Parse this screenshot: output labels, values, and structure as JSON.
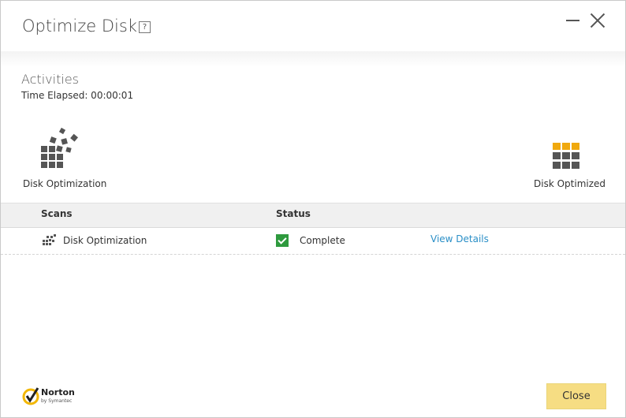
{
  "window": {
    "title": "Optimize Disk",
    "help_label": "?"
  },
  "activities": {
    "heading": "Activities",
    "elapsed": "Time Elapsed: 00:00:01"
  },
  "stages": {
    "left_label": "Disk Optimization",
    "right_label": "Disk Optimized",
    "right_icon_color": "#f0a90e",
    "left_icon_color": "#555555"
  },
  "table": {
    "headers": {
      "scans": "Scans",
      "status": "Status"
    },
    "rows": [
      {
        "name": "Disk Optimization",
        "status": "Complete",
        "link": "View Details"
      }
    ]
  },
  "footer": {
    "brand": "Norton",
    "brand_sub": "by Symantec",
    "close_label": "Close"
  },
  "colors": {
    "accent_link": "#2a8fc7",
    "status_ok": "#2e9a3e",
    "close_button": "#f6dd83"
  }
}
